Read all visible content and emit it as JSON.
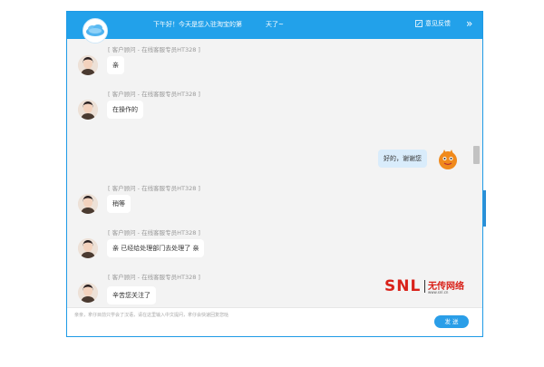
{
  "header": {
    "greeting": "下午好！今天是您入驻淘宝的第",
    "greeting_tail": "天了~",
    "feedback_label": "意见反馈",
    "collapse_label": "»"
  },
  "messages": [
    {
      "sender": "[ 客户顾问  -  在线客服专员HT328 ]",
      "text": "亲"
    },
    {
      "sender": "[ 客户顾问  -  在线客服专员HT328 ]",
      "text": "在操作的"
    },
    {
      "text": "好的，谢谢您"
    },
    {
      "sender": "[ 客户顾问  -  在线客服专员HT328 ]",
      "text": "稍等"
    },
    {
      "sender": "[ 客户顾问  -  在线客服专员HT328 ]",
      "text": "亲 已经给处理部门去处理了 亲"
    },
    {
      "sender": "[ 客户顾问  -  在线客服专员HT328 ]",
      "text": "辛苦您关注了"
    }
  ],
  "input": {
    "placeholder": "亲亲，拿仔目前只学会了汉语，请在这里输入中文提问，拿仔会快速回复您哒"
  },
  "send_label": "发 送",
  "watermark": {
    "brand": "SNL",
    "name": "无传网络",
    "url": "www.snl.cn"
  },
  "colors": {
    "accent": "#22a1ea",
    "user_bubble": "#d9ecfb",
    "watermark_red": "#d9221a"
  }
}
